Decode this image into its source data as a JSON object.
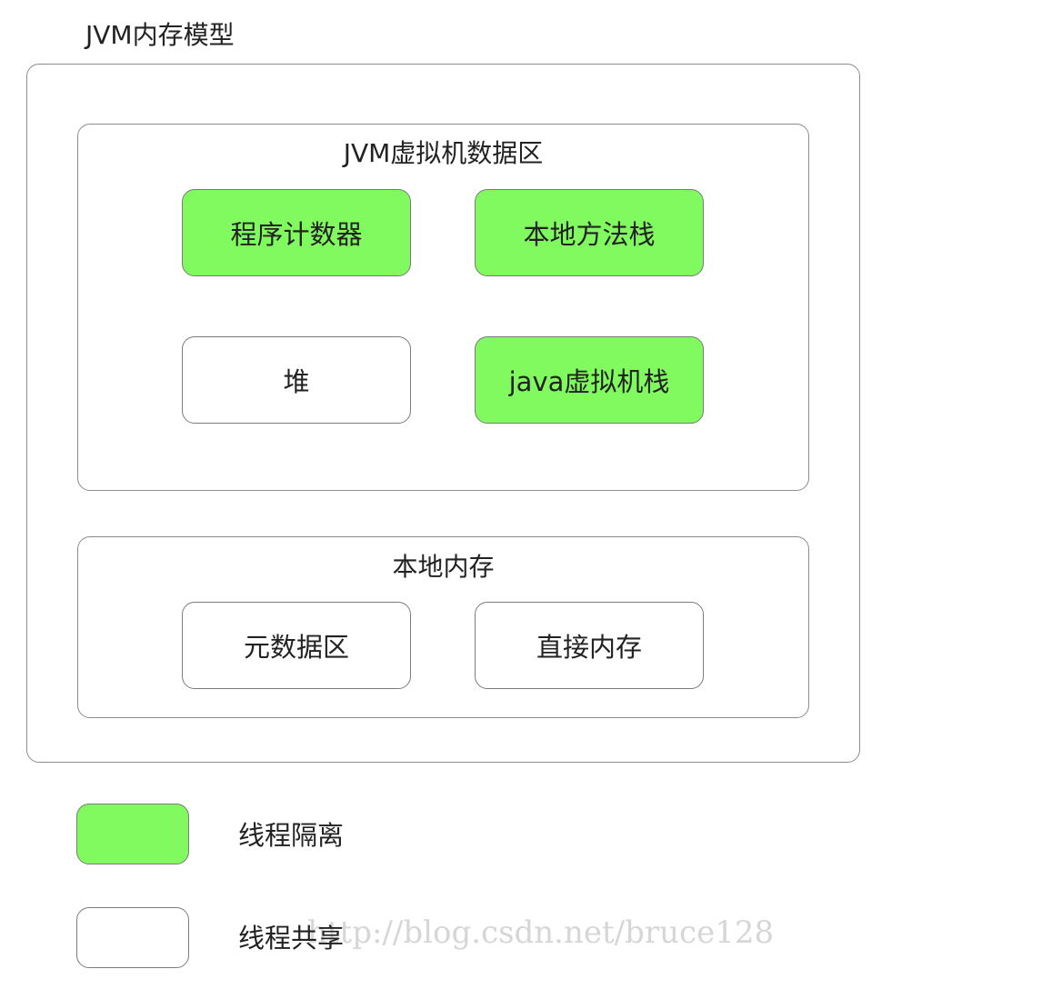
{
  "title": "JVM内存模型",
  "groups": {
    "runtime_data_area": {
      "label": "JVM虚拟机数据区",
      "items": [
        {
          "label": "程序计数器",
          "kind": "线程隔离"
        },
        {
          "label": "本地方法栈",
          "kind": "线程隔离"
        },
        {
          "label": "堆",
          "kind": "线程共享"
        },
        {
          "label": "java虚拟机栈",
          "kind": "线程隔离"
        }
      ]
    },
    "native_memory": {
      "label": "本地内存",
      "items": [
        {
          "label": "元数据区",
          "kind": "线程共享"
        },
        {
          "label": "直接内存",
          "kind": "线程共享"
        }
      ]
    }
  },
  "legend": [
    {
      "label": "线程隔离",
      "color": "#80fa5e"
    },
    {
      "label": "线程共享",
      "color": "#ffffff"
    }
  ],
  "watermark": "http://blog.csdn.net/bruce128"
}
